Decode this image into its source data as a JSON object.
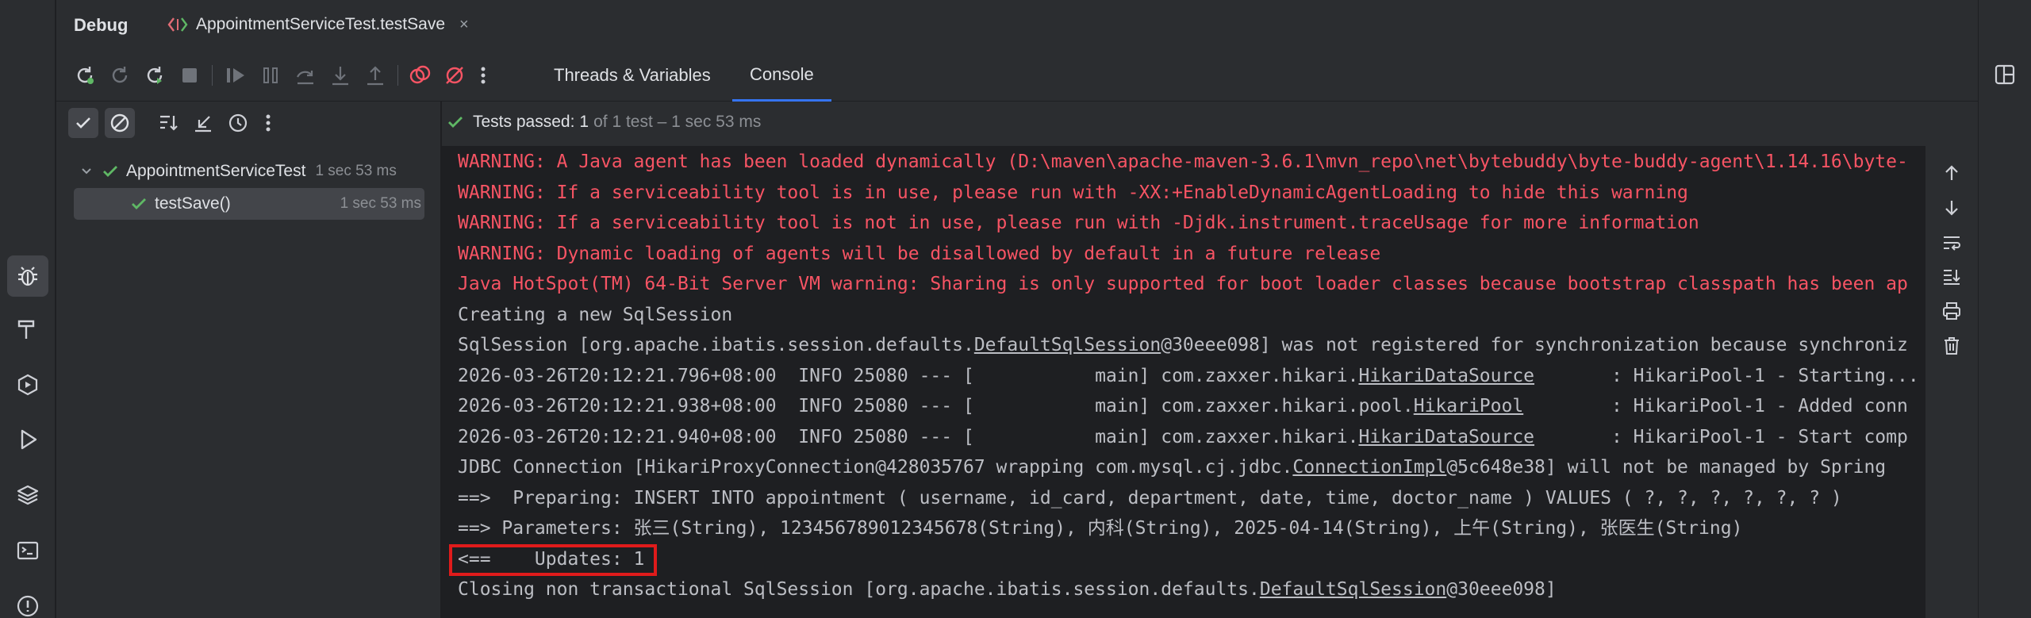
{
  "debug_title": "Debug",
  "file_tab": {
    "label": "AppointmentServiceTest.testSave",
    "close": "×"
  },
  "view_tabs": [
    "Threads & Variables",
    "Console"
  ],
  "status": {
    "label": "Tests passed:",
    "count": "1",
    "detail": "of 1 test – 1 sec 53 ms"
  },
  "tree": {
    "root": {
      "label": "AppointmentServiceTest",
      "duration": "1 sec 53 ms"
    },
    "child": {
      "label": "testSave()",
      "duration": "1 sec 53 ms"
    }
  },
  "console_lines": [
    {
      "type": "err",
      "text": "WARNING: A Java agent has been loaded dynamically (D:\\maven\\apache-maven-3.6.1\\mvn_repo\\net\\bytebuddy\\byte-buddy-agent\\1.14.16\\byte-"
    },
    {
      "type": "err",
      "text": "WARNING: If a serviceability tool is in use, please run with -XX:+EnableDynamicAgentLoading to hide this warning"
    },
    {
      "type": "err",
      "text": "WARNING: If a serviceability tool is not in use, please run with -Djdk.instrument.traceUsage for more information"
    },
    {
      "type": "err",
      "text": "WARNING: Dynamic loading of agents will be disallowed by default in a future release"
    },
    {
      "type": "err",
      "text": "Java HotSpot(TM) 64-Bit Server VM warning: Sharing is only supported for boot loader classes because bootstrap classpath has been ap"
    },
    {
      "type": "out",
      "text": "Creating a new SqlSession"
    },
    {
      "type": "out",
      "pre": "SqlSession [org.apache.ibatis.session.defaults.",
      "link": "DefaultSqlSession",
      "post": "@30eee098] was not registered for synchronization because synchroniz"
    },
    {
      "type": "out",
      "pre": "2026-03-26T20:12:21.796+08:00  INFO 25080 --- [           main] com.zaxxer.hikari.",
      "link": "HikariDataSource",
      "post": "       : HikariPool-1 - Starting..."
    },
    {
      "type": "out",
      "pre": "2026-03-26T20:12:21.938+08:00  INFO 25080 --- [           main] com.zaxxer.hikari.pool.",
      "link": "HikariPool",
      "post": "        : HikariPool-1 - Added conn"
    },
    {
      "type": "out",
      "pre": "2026-03-26T20:12:21.940+08:00  INFO 25080 --- [           main] com.zaxxer.hikari.",
      "link": "HikariDataSource",
      "post": "       : HikariPool-1 - Start comp"
    },
    {
      "type": "out",
      "pre": "JDBC Connection [HikariProxyConnection@428035767 wrapping com.mysql.cj.jdbc.",
      "link": "ConnectionImpl",
      "post": "@5c648e38] will not be managed by Spring"
    },
    {
      "type": "out",
      "text": "==>  Preparing: INSERT INTO appointment ( username, id_card, department, date, time, doctor_name ) VALUES ( ?, ?, ?, ?, ?, ? )"
    },
    {
      "type": "out",
      "text": "==> Parameters: 张三(String), 123456789012345678(String), 内科(String), 2025-04-14(String), 上午(String), 张医生(String)"
    },
    {
      "type": "out",
      "text": "<==    Updates: 1"
    },
    {
      "type": "out",
      "pre": "Closing non transactional SqlSession [org.apache.ibatis.session.defaults.",
      "link": "DefaultSqlSession",
      "post": "@30eee098]"
    }
  ],
  "colors": {
    "error": "#f75464",
    "normal": "#bcbec4",
    "pass": "#5fb865",
    "accent": "#3574f0",
    "highlight": "#e01b1b"
  }
}
